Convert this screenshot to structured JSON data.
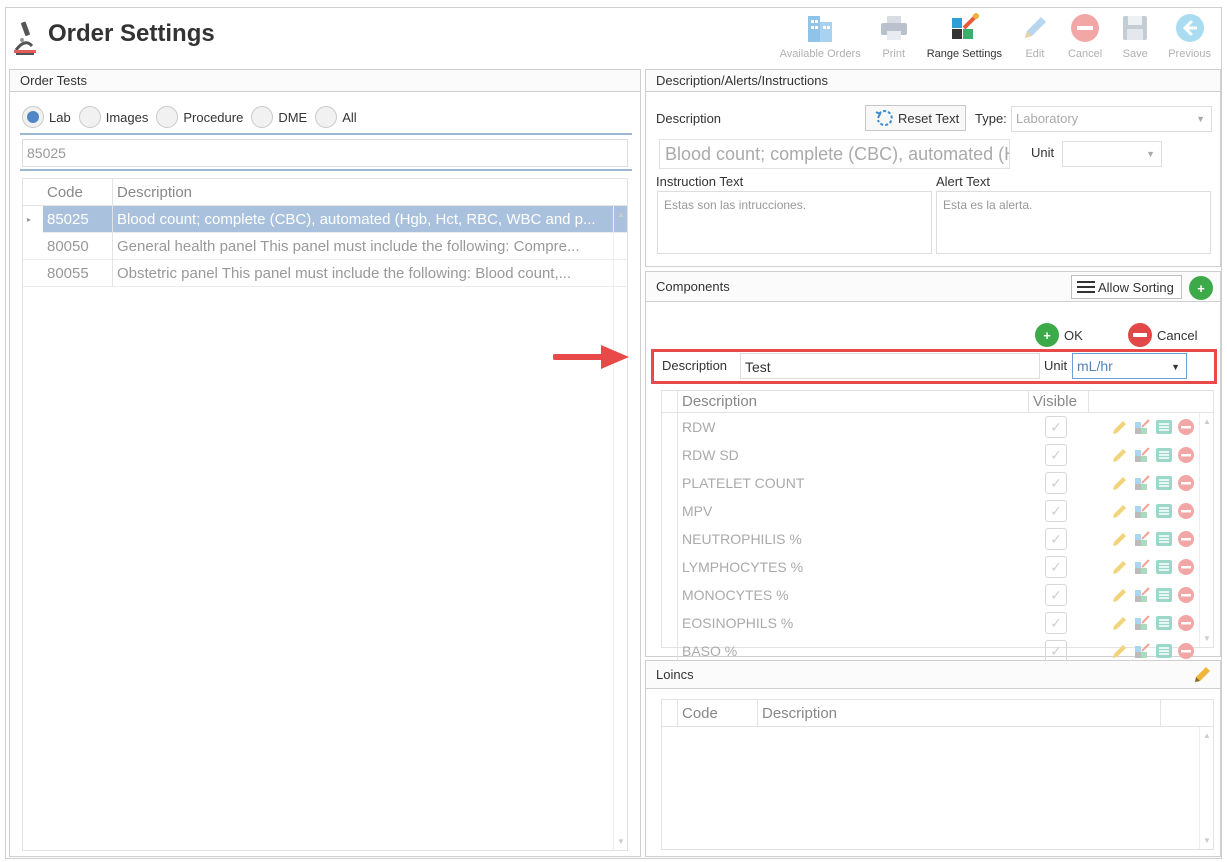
{
  "app": {
    "title": "Order Settings"
  },
  "toolbar": {
    "available_orders": "Available Orders",
    "print": "Print",
    "range_settings": "Range Settings",
    "edit": "Edit",
    "cancel": "Cancel",
    "save": "Save",
    "previous": "Previous"
  },
  "order_tests": {
    "header": "Order Tests",
    "radios": [
      {
        "label": "Lab",
        "checked": true
      },
      {
        "label": "Images",
        "checked": false
      },
      {
        "label": "Procedure",
        "checked": false
      },
      {
        "label": "DME",
        "checked": false
      },
      {
        "label": "All",
        "checked": false
      }
    ],
    "search_value": "85025",
    "columns": [
      "Code",
      "Description"
    ],
    "rows": [
      {
        "code": "85025",
        "description": "Blood count; complete (CBC), automated (Hgb, Hct, RBC, WBC and p...",
        "selected": true
      },
      {
        "code": "80050",
        "description": "General health panel This panel must include the following: Compre...",
        "selected": false
      },
      {
        "code": "80055",
        "description": "Obstetric panel This panel must include the following: Blood count,...",
        "selected": false
      }
    ]
  },
  "description_panel": {
    "header": "Description/Alerts/Instructions",
    "description_label": "Description",
    "reset_text": "Reset Text",
    "type_label": "Type:",
    "type_value": "Laboratory",
    "description_value": "Blood count; complete (CBC), automated (H",
    "unit_label": "Unit",
    "unit_value": "",
    "instruction_label": "Instruction Text",
    "instruction_value": "Estas son las intrucciones.",
    "alert_label": "Alert Text",
    "alert_value": "Esta es la alerta."
  },
  "components": {
    "header": "Components",
    "allow_sorting": "Allow Sorting",
    "ok": "OK",
    "cancel": "Cancel",
    "edit_row": {
      "description_label": "Description",
      "description_value": "Test",
      "unit_label": "Unit",
      "unit_value": "mL/hr"
    },
    "columns": [
      "Description",
      "Visible"
    ],
    "rows": [
      "RDW",
      "RDW SD",
      "PLATELET COUNT",
      "MPV",
      "NEUTROPHILIS %",
      "LYMPHOCYTES %",
      "MONOCYTES %",
      "EOSINOPHILS %",
      "BASO %"
    ]
  },
  "loincs": {
    "header": "Loincs",
    "columns": [
      "Code",
      "Description"
    ]
  },
  "colors": {
    "accent_blue": "#4f87c5",
    "selection": "#a9c1dc",
    "highlight_red": "#e84a4a",
    "green": "#3daa4a"
  }
}
